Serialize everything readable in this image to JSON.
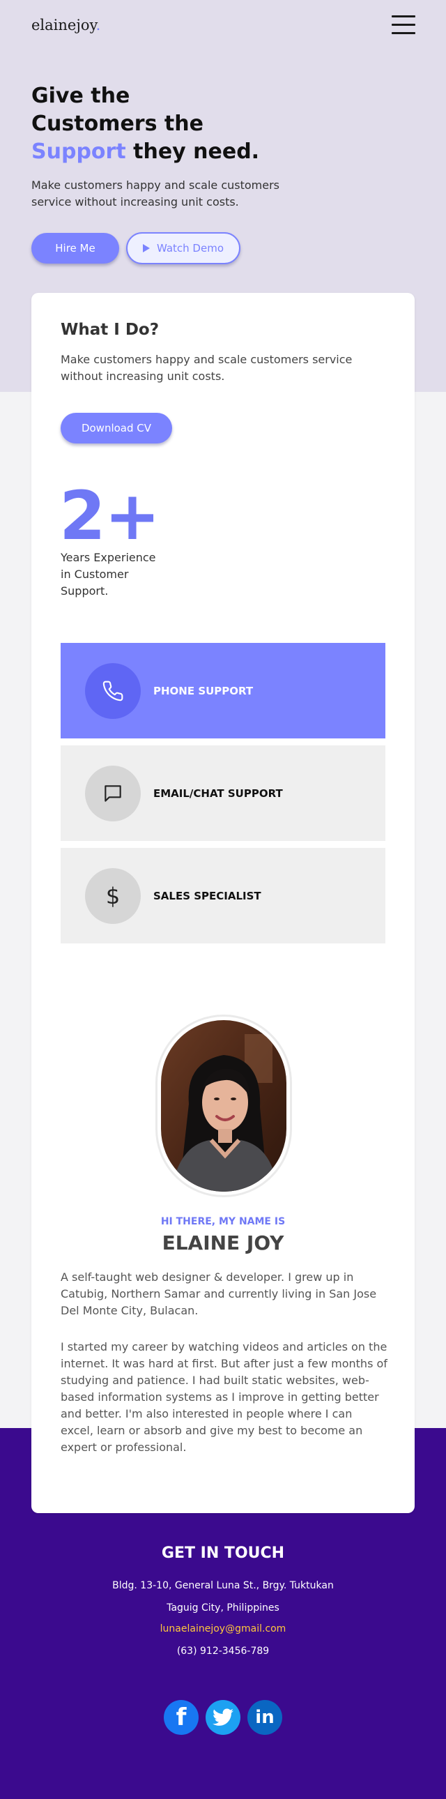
{
  "brand": {
    "logo": "elainejoy",
    "logo_dot": "."
  },
  "hero": {
    "title_line1": "Give the",
    "title_line2": "Customers the",
    "title_accent": "Support",
    "title_end": " they need.",
    "subtitle": "Make customers happy and scale customers service without increasing unit costs.",
    "hire_label": "Hire Me",
    "demo_label": "Watch Demo"
  },
  "what": {
    "title": "What I Do?",
    "description": "Make customers happy and scale customers service without increasing unit costs.",
    "cv_label": "Download CV",
    "years": "2+",
    "years_text": "Years Experience in Customer Support."
  },
  "services": [
    {
      "label": "PHONE SUPPORT",
      "icon": "phone-icon"
    },
    {
      "label": "EMAIL/CHAT SUPPORT",
      "icon": "chat-icon"
    },
    {
      "label": "SALES SPECIALIST",
      "icon": "dollar-icon"
    }
  ],
  "about": {
    "greeting": "HI THERE, MY NAME IS",
    "name": "ELAINE JOY",
    "bio1": "A self-taught web designer & developer. I grew up in Catubig, Northern Samar and currently living in San Jose Del Monte City, Bulacan.",
    "bio2": "I started my career by watching videos and articles on the internet. It was hard at first. But after just a few months of studying and patience. I had built static websites, web-based information systems as I improve in getting better and better. I'm also interested in people where I can excel, learn or absorb and give my best to become an expert or professional."
  },
  "contact": {
    "title": "GET IN TOUCH",
    "address1": "Bldg. 13-10, General Luna St., Brgy. Tuktukan",
    "address2": "Taguig City, Philippines",
    "email": "lunaelainejoy@gmail.com",
    "phone": "(63) 912-3456-789"
  },
  "social": {
    "facebook": "f",
    "linkedin": "in"
  },
  "colors": {
    "accent": "#7b83ff",
    "hero_bg": "#e1ddeb",
    "footer_bg": "#3b0a8e",
    "email": "#ffc73d"
  }
}
